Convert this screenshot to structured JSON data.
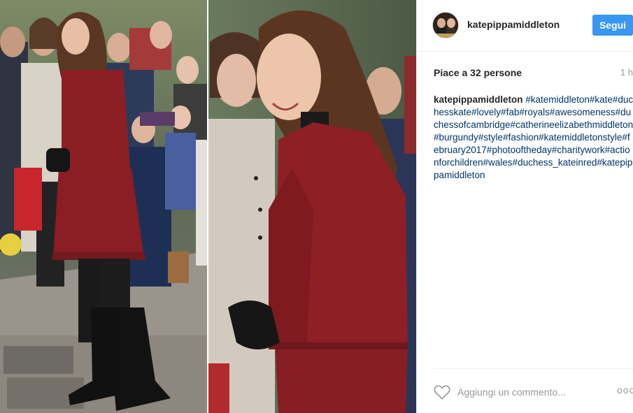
{
  "post": {
    "username": "katepippamiddleton",
    "follow_label": "Segui",
    "likes": "Piace a 32 persone",
    "time": "1 h",
    "caption_user": "katepippamiddleton",
    "caption_tags": "#katemiddleton#kate#duchesskate#lovely#fab#royals#awesomeness#duchessofcambridge#catherineelizabethmiddleton#burgundy#style#fashion#katemiddletonstyle#february2017#photooftheday#charitywork#actionforchildren#wales#duchess_kateinred#katepippamiddleton",
    "comment_placeholder": "Aggiungi un commento...",
    "more_label": "ooo"
  },
  "colors": {
    "accent": "#3897f0",
    "hashtag": "#003569",
    "coat": "#8c1f24"
  },
  "icons": {
    "heart": "heart-icon",
    "more": "more-options-icon",
    "avatar": "avatar"
  }
}
